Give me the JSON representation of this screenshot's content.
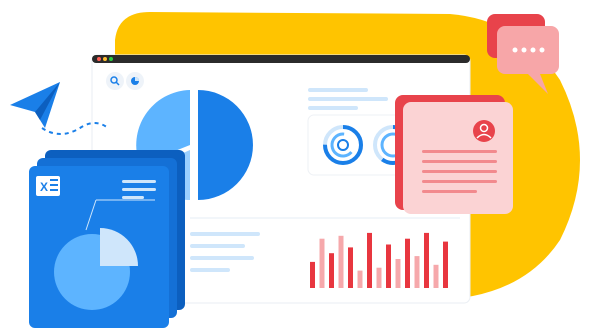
{
  "colors": {
    "yellow_blob": "#ffc400",
    "window_bg": "#ffffff",
    "window_bar": "#2b2b2b",
    "dot_red": "#ff5f56",
    "dot_yellow": "#ffbd2e",
    "dot_green": "#27c93f",
    "blue_primary": "#1a7fe8",
    "blue_light": "#5db4ff",
    "blue_pale": "#cfe6fb",
    "line_pale": "#dbe9f8",
    "bar_red": "#e8363f",
    "bar_pink": "#f6a8ab",
    "card_pink": "#fbd3d4",
    "card_red": "#e8434b",
    "chat_pink": "#f7a6a8",
    "plane_blue": "#1a7fe8"
  },
  "icons": {
    "search": "search-icon",
    "pie_small": "pie-chart-icon",
    "user": "user-icon",
    "excel": "excel-icon",
    "chat": "chat-bubble-icon",
    "plane": "paper-plane-icon"
  },
  "main_pie": {
    "slices": [
      0.33,
      0.67
    ],
    "note": ""
  },
  "bar_chart": {
    "values": [
      0.45,
      0.85,
      0.6,
      0.9,
      0.7,
      0.3,
      0.95,
      0.35,
      0.75,
      0.5,
      0.85,
      0.55,
      0.95,
      0.4,
      0.8
    ]
  },
  "file_pie": {
    "slices": [
      0.22,
      0.78
    ]
  },
  "progress_rings": {
    "values": [
      0.75,
      0.6
    ]
  }
}
